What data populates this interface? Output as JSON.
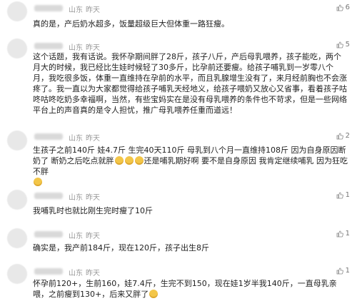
{
  "comments": [
    {
      "location": "山东",
      "time": "昨天",
      "likes": "6",
      "text": "真的是，产后奶水超多，饭量超级巨大但体重一路狂瘦。"
    },
    {
      "location": "山东",
      "time": "昨天",
      "likes": "5",
      "text": "这个话题，我有话说。我怀孕期间胖了28斤，孩子八斤，产后母乳喂养，孩子能吃，两个月大的时候，我已经比生娃时候轻了30多斤，比孕前还要瘦。给孩子哺乳到一岁零八个月，我吃很多饭，体重一直维持在孕前的水平，而且乳腺增生没有了，来月经前胸也不会涨疼了。我一直以为大家都觉得给孩子哺乳天经地义，给孩子喂奶又放心又省事，看着孩子咕咚咕咚吃奶多幸福啊，当然，有些宝妈实在是没有母乳喂养的条件也不苛求，但是一些网络平台上的声音真的是令人担忧，推广母乳喂养任重而道远！"
    },
    {
      "location": "山东",
      "time": "昨天",
      "likes": "2",
      "text_a": "生孩子之前140斤  娃4.7斤  生完40天110斤  母乳到八个月一直维持108斤  因为自身原因断奶了  断奶之后吃点就胖",
      "text_b": "还是哺乳期好啊  要不是自身原因 我肯定继续哺乳  因为狂吃不胖",
      "emoji_mid": "face-emoji",
      "emoji_end": "face-emoji"
    },
    {
      "location": "山东",
      "time": "昨天",
      "likes": "1",
      "text": "我哺乳时也就比刚生完时瘦了10斤"
    },
    {
      "location": "山东",
      "time": "昨天",
      "likes": "1",
      "text": "确实是，我产前184斤，现在120斤，孩子出生8斤"
    },
    {
      "location": "山东",
      "time": "昨天",
      "likes": "1",
      "text": "怀孕前120+，生前160，娃7.4斤，生完不到150，现在娃1岁半我140斤，一直母乳亲喂，之前瘦到130+，后来又胖了",
      "emoji_end": "face-emoji"
    }
  ],
  "colors": {
    "meta": "#999999",
    "text": "#1f1f1f",
    "likes": "#777777"
  }
}
